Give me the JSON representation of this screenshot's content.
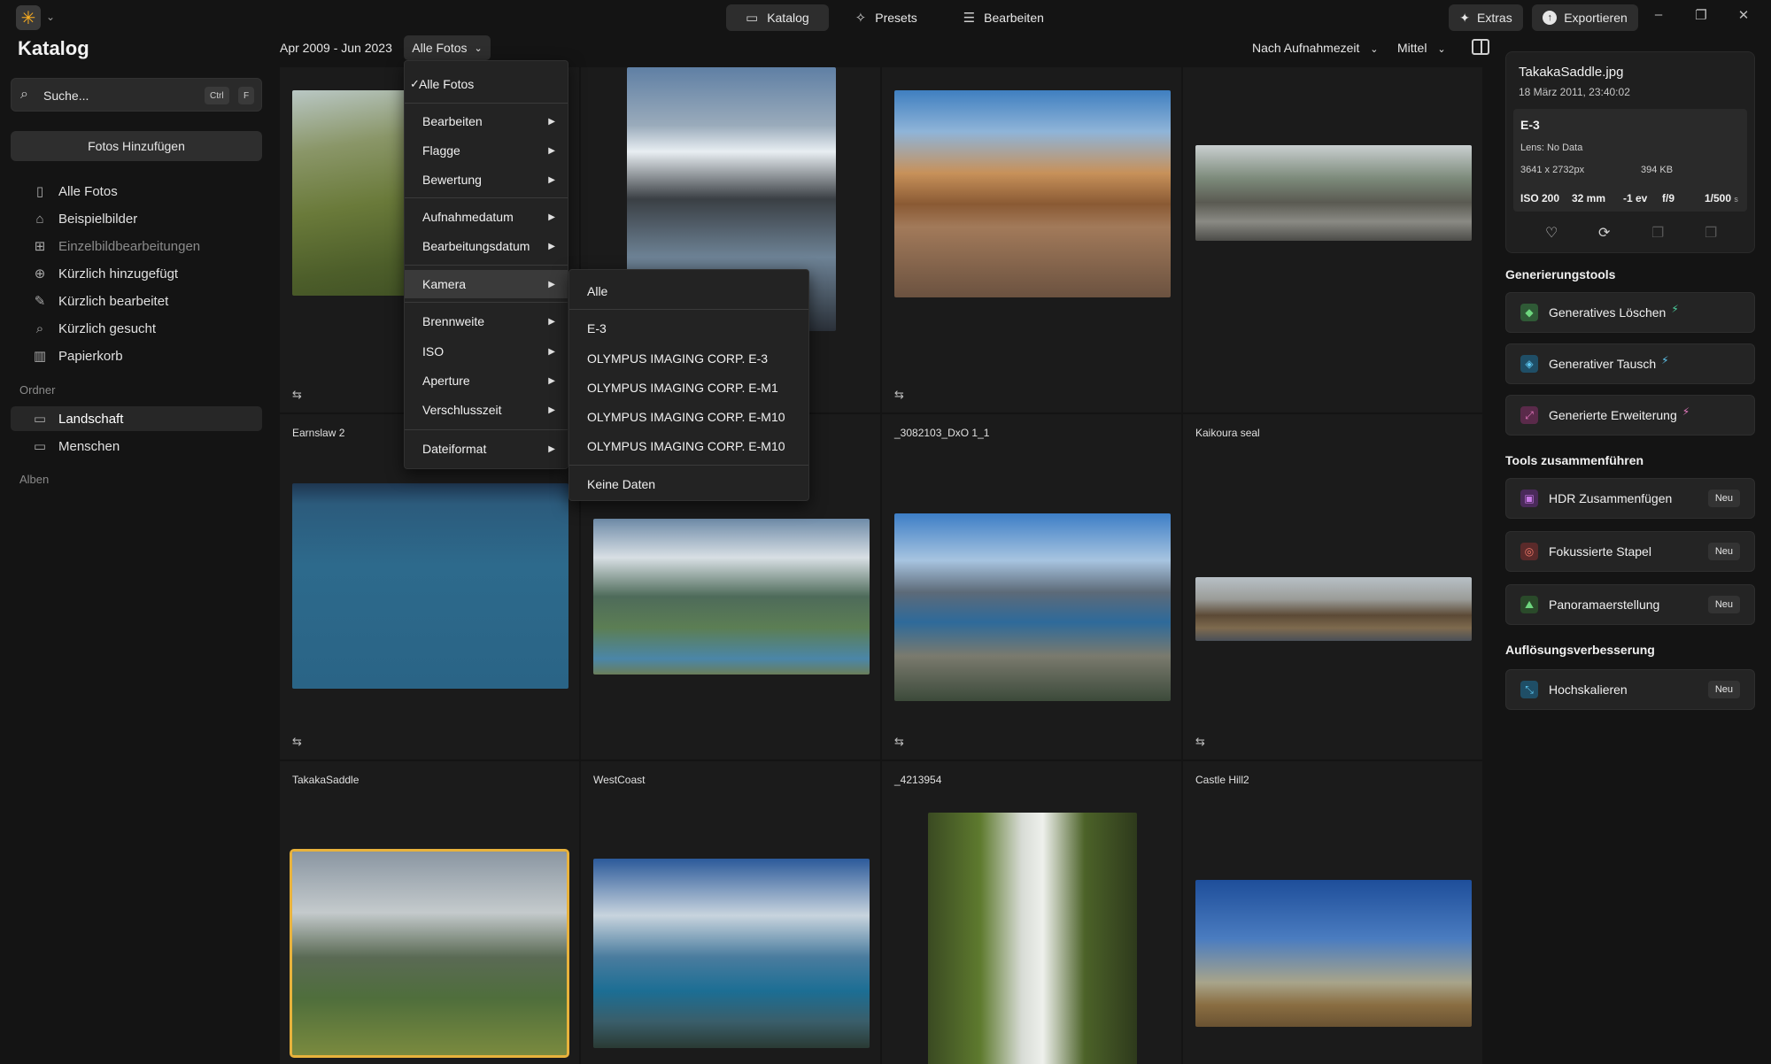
{
  "topbar": {
    "tabs": [
      {
        "label": "Katalog",
        "icon": "folder-icon",
        "active": true
      },
      {
        "label": "Presets",
        "icon": "sparkle-icon",
        "active": false
      },
      {
        "label": "Bearbeiten",
        "icon": "sliders-icon",
        "active": false
      }
    ],
    "extras_label": "Extras",
    "export_label": "Exportieren"
  },
  "sidebar": {
    "title": "Katalog",
    "search_placeholder": "Suche...",
    "search_shortcut": [
      "Ctrl",
      "F"
    ],
    "add_photos_label": "Fotos Hinzufügen",
    "library": [
      {
        "label": "Alle Fotos",
        "icon": "photos-icon",
        "dim": false
      },
      {
        "label": "Beispielbilder",
        "icon": "graduation-cap-icon",
        "dim": false
      },
      {
        "label": "Einzelbildbearbeitungen",
        "icon": "grid-icon",
        "dim": true
      },
      {
        "label": "Kürzlich hinzugefügt",
        "icon": "recent-add-icon",
        "dim": false
      },
      {
        "label": "Kürzlich bearbeitet",
        "icon": "recent-edit-icon",
        "dim": false
      },
      {
        "label": "Kürzlich gesucht",
        "icon": "search-icon",
        "dim": false
      },
      {
        "label": "Papierkorb",
        "icon": "trash-icon",
        "dim": false
      }
    ],
    "folders_label": "Ordner",
    "folders": [
      {
        "label": "Landschaft",
        "active": true
      },
      {
        "label": "Menschen",
        "active": false
      }
    ],
    "albums_label": "Alben"
  },
  "toolbar": {
    "date_range": "Apr 2009 - Jun 2023",
    "filter_label": "Alle Fotos",
    "sort_label": "Nach Aufnahmezeit",
    "size_label": "Mittel"
  },
  "filter_menu": {
    "items": [
      {
        "label": "Alle Fotos",
        "checked": true,
        "submenu": false
      },
      {
        "label": "Bearbeiten",
        "submenu": true
      },
      {
        "label": "Flagge",
        "submenu": true
      },
      {
        "label": "Bewertung",
        "submenu": true
      },
      {
        "label": "Aufnahmedatum",
        "submenu": true
      },
      {
        "label": "Bearbeitungsdatum",
        "submenu": true
      },
      {
        "label": "Kamera",
        "submenu": true
      },
      {
        "label": "Brennweite",
        "submenu": true
      },
      {
        "label": "ISO",
        "submenu": true
      },
      {
        "label": "Aperture",
        "submenu": true
      },
      {
        "label": "Verschlusszeit",
        "submenu": true
      },
      {
        "label": "Dateiformat",
        "submenu": true
      }
    ],
    "check_mark": "✓",
    "camera_submenu": [
      "Alle",
      "E-3",
      "OLYMPUS IMAGING CORP.  E-3",
      "OLYMPUS IMAGING CORP.  E-M1",
      "OLYMPUS IMAGING CORP.  E-M10",
      "OLYMPUS IMAGING CORP.  E-M10",
      "Keine Daten"
    ]
  },
  "grid": {
    "names": [
      "Earnslaw 2",
      "_3082103_DxO 1_1",
      "Kaikoura seal",
      "TakakaSaddle",
      "WestCoast",
      "_4213954",
      "Castle Hill2"
    ]
  },
  "info": {
    "filename": "TakakaSaddle.jpg",
    "date": "18 März 2011, 23:40:02",
    "camera": "E-3",
    "lens": "Lens: No Data",
    "resolution": "3641 x 2732px",
    "filesize": "394 KB",
    "iso": "ISO 200",
    "focal": "32 mm",
    "ev": "-1 ev",
    "aperture": "f/9",
    "shutter": "1/500",
    "shutter_unit": "s"
  },
  "tools": {
    "gen_heading": "Generierungstools",
    "gen": [
      "Generatives Löschen",
      "Generativer Tausch",
      "Generierte Erweiterung"
    ],
    "merge_heading": "Tools zusammenführen",
    "merge": [
      "HDR Zusammenfügen",
      "Fokussierte Stapel",
      "Panoramaerstellung"
    ],
    "res_heading": "Auflösungsverbesserung",
    "res": [
      "Hochskalieren"
    ],
    "new_badge": "Neu"
  }
}
